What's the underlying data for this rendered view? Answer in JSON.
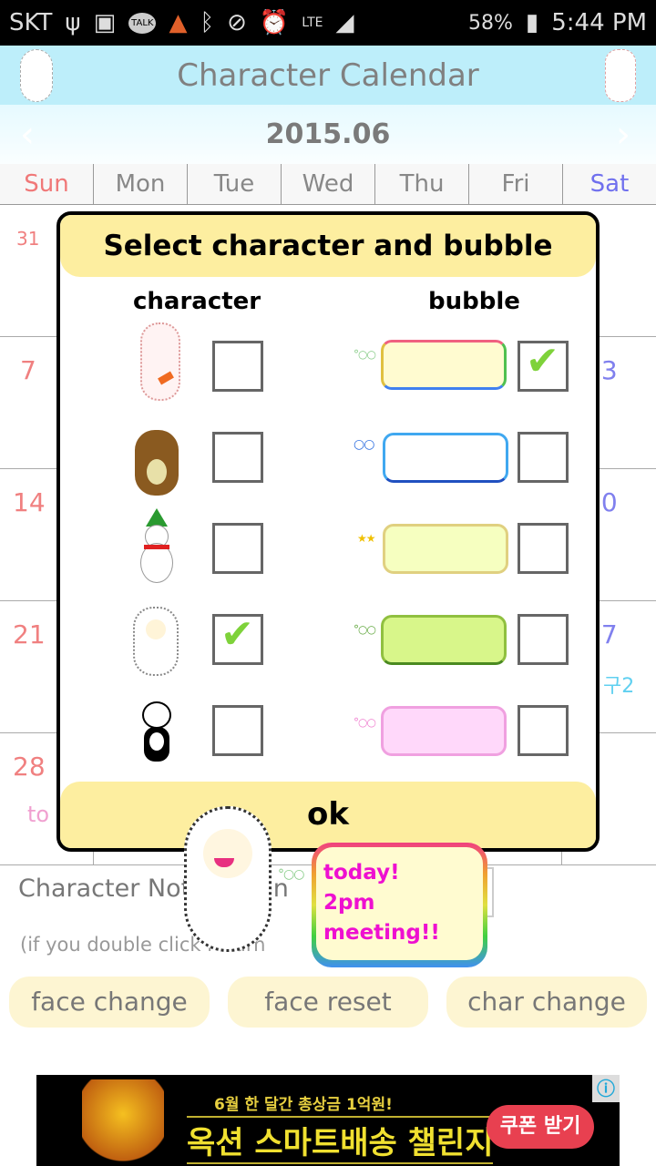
{
  "status_bar": {
    "carrier": "SKT",
    "battery": "58%",
    "time": "5:44 PM",
    "icons": [
      "usb-icon",
      "gallery-icon",
      "talk-icon",
      "alert-icon",
      "bluetooth-icon",
      "mute-icon",
      "alarm-icon",
      "lte-icon",
      "signal-icon",
      "battery-charging-icon"
    ],
    "talk_label": "TALK",
    "lte_label": "LTE"
  },
  "header": {
    "title": "Character Calendar"
  },
  "calendar": {
    "month": "2015.06",
    "weekdays": [
      "Sun",
      "Mon",
      "Tue",
      "Wed",
      "Thu",
      "Fri",
      "Sat"
    ],
    "sundays": [
      "31",
      "7",
      "14",
      "21",
      "28"
    ],
    "saturdays": [
      "13",
      "20",
      "27"
    ],
    "sat_note": "구2",
    "sun_note": "to"
  },
  "dialog": {
    "title": "Select character and bubble",
    "character_label": "character",
    "bubble_label": "bubble",
    "characters": [
      {
        "name": "bunny",
        "checked": false
      },
      {
        "name": "bear",
        "checked": false
      },
      {
        "name": "snowman",
        "checked": false
      },
      {
        "name": "sheep",
        "checked": true
      },
      {
        "name": "panda",
        "checked": false
      }
    ],
    "bubbles": [
      {
        "name": "rainbow",
        "checked": true
      },
      {
        "name": "blue",
        "checked": false
      },
      {
        "name": "gold",
        "checked": false
      },
      {
        "name": "green",
        "checked": false
      },
      {
        "name": "pink",
        "checked": false
      }
    ],
    "ok_label": "ok"
  },
  "notification": {
    "label": "Character Notification",
    "hint": "(if you double click return"
  },
  "floating": {
    "bubble_lines": [
      "today!",
      "2pm",
      "meeting!!"
    ]
  },
  "buttons": {
    "face_change": "face change",
    "face_reset": "face reset",
    "char_change": "char change"
  },
  "ad": {
    "line1": "6월 한 달간 총상금 1억원!",
    "line2": "옥션 스마트배송 챌린지",
    "cta": "쿠폰 받기"
  },
  "colors": {
    "header_bg": "#bdeefa",
    "dialog_yellow": "#fdeea0",
    "sunday": "#f08080",
    "saturday": "#8080ee",
    "button_bg": "#fdf5d2",
    "bubble_text": "#ee10d0"
  }
}
